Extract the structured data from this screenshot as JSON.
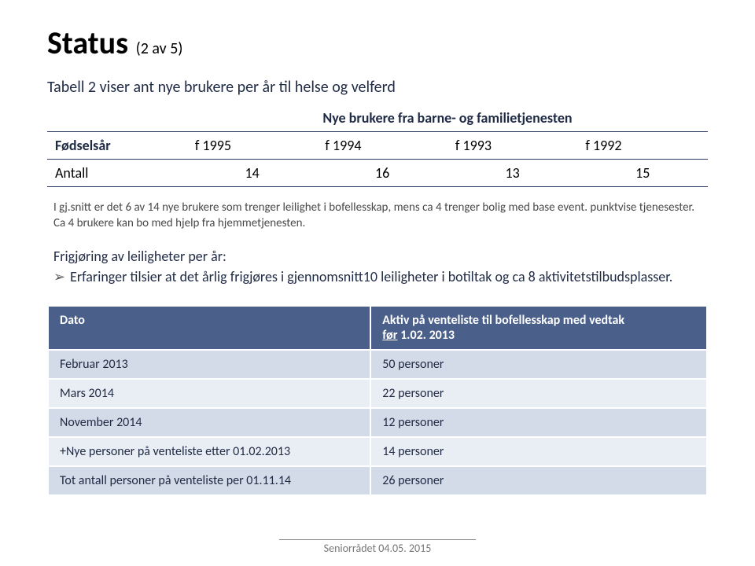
{
  "title": {
    "main": "Status",
    "sub": "(2 av 5)"
  },
  "caption1": "Tabell 2 viser ant nye brukere per år til helse og velferd",
  "table1": {
    "subtitle": "Nye brukere fra barne- og familietjenesten",
    "rowhead1": "Fødselsår",
    "cols": [
      "f 1995",
      "f 1994",
      "f 1993",
      "f 1992"
    ],
    "rowhead2": "Antall",
    "vals": [
      "14",
      "16",
      "13",
      "15"
    ]
  },
  "note": "I gj.snitt er det 6 av 14 nye brukere som trenger leilighet i bofellesskap, mens ca 4 trenger bolig med base event. punktvise tjenesester. Ca 4 brukere kan bo med hjelp fra hjemmetjenesten.",
  "para_lead": "Frigjøring av leiligheter per år:",
  "bullet": "Erfaringer tilsier at det årlig frigjøres  i gjennomsnitt10 leiligheter i botiltak og ca 8 aktivitetstilbudsplasser.",
  "table2": {
    "head": {
      "c1": "Dato",
      "c2a": "Aktiv på venteliste til bofellesskap med vedtak",
      "c2b_under": "før",
      "c2b_rest": " 1.02. 2013"
    },
    "rows": [
      {
        "c1": "Februar 2013",
        "c2": "50 personer"
      },
      {
        "c1": "Mars 2014",
        "c2": "22 personer"
      },
      {
        "c1": "November 2014",
        "c2": "12 personer"
      },
      {
        "c1": "+Nye personer på venteliste etter 01.02.2013",
        "c2": "14 personer"
      },
      {
        "c1": "Tot antall personer på venteliste per 01.11.14",
        "c2": "26 personer"
      }
    ]
  },
  "footer": "Seniorrådet 04.05. 2015",
  "chart_data": [
    {
      "type": "table",
      "title": "Tabell 2 viser ant nye brukere per år til helse og velferd — Nye brukere fra barne- og familietjenesten",
      "columns": [
        "Fødselsår",
        "f 1995",
        "f 1994",
        "f 1993",
        "f 1992"
      ],
      "rows": [
        {
          "Fødselsår": "Antall",
          "f 1995": 14,
          "f 1994": 16,
          "f 1993": 13,
          "f 1992": 15
        }
      ]
    },
    {
      "type": "table",
      "title": "Aktiv på venteliste til bofellesskap med vedtak før 1.02. 2013",
      "columns": [
        "Dato",
        "Aktiv på venteliste til bofellesskap med vedtak før 1.02. 2013"
      ],
      "rows": [
        {
          "Dato": "Februar 2013",
          "Aktiv på venteliste til bofellesskap med vedtak før 1.02. 2013": "50 personer"
        },
        {
          "Dato": "Mars 2014",
          "Aktiv på venteliste til bofellesskap med vedtak før 1.02. 2013": "22 personer"
        },
        {
          "Dato": "November 2014",
          "Aktiv på venteliste til bofellesskap med vedtak før 1.02. 2013": "12 personer"
        },
        {
          "Dato": "+Nye personer på venteliste etter 01.02.2013",
          "Aktiv på venteliste til bofellesskap med vedtak før 1.02. 2013": "14 personer"
        },
        {
          "Dato": "Tot antall personer på venteliste per 01.11.14",
          "Aktiv på venteliste til bofellesskap med vedtak før 1.02. 2013": "26 personer"
        }
      ]
    }
  ]
}
